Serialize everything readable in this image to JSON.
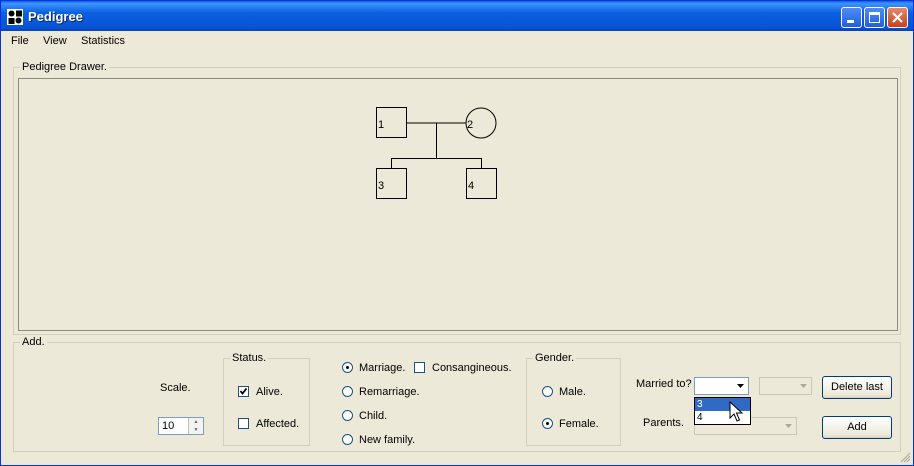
{
  "window": {
    "title": "Pedigree",
    "icon": "pedigree-app-icon"
  },
  "menu": {
    "items": [
      "File",
      "View",
      "Statistics"
    ]
  },
  "drawer": {
    "legend": "Pedigree Drawer.",
    "nodes": [
      {
        "label": "1",
        "shape": "square"
      },
      {
        "label": "2",
        "shape": "circle"
      },
      {
        "label": "3",
        "shape": "square"
      },
      {
        "label": "4",
        "shape": "square"
      }
    ]
  },
  "add": {
    "legend": "Add.",
    "scale": {
      "label": "Scale.",
      "value": "10"
    },
    "status": {
      "legend": "Status.",
      "alive": {
        "label": "Alive.",
        "checked": true
      },
      "affected": {
        "label": "Affected.",
        "checked": false
      }
    },
    "relation": {
      "options": [
        {
          "label": "Marriage.",
          "selected": true
        },
        {
          "label": "Remarriage.",
          "selected": false
        },
        {
          "label": "Child.",
          "selected": false
        },
        {
          "label": "New family.",
          "selected": false
        }
      ],
      "consanguineous": {
        "label": "Consangineous.",
        "checked": false
      }
    },
    "gender": {
      "legend": "Gender.",
      "male": {
        "label": "Male.",
        "selected": false
      },
      "female": {
        "label": "Female.",
        "selected": true
      }
    },
    "married_to": {
      "label": "Married to?",
      "value": "",
      "options": [
        "3",
        "4"
      ],
      "highlighted": "3"
    },
    "parents": {
      "label": "Parents.",
      "value": ""
    },
    "delete_last_label": "Delete last",
    "add_label": "Add"
  },
  "colors": {
    "titlebar": "#0a5fe0",
    "window_bg": "#ece9d8",
    "highlight": "#316ac5"
  }
}
